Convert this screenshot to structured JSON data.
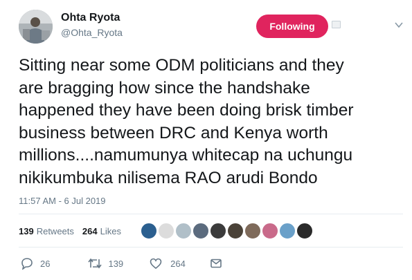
{
  "author": {
    "name": "Ohta Ryota",
    "handle": "@Ohta_Ryota",
    "avatar_icon": "user-photo"
  },
  "follow_button": {
    "label": "Following",
    "color": "#e0245e"
  },
  "tweet": {
    "text": "Sitting near some ODM politicians and they\nare bragging how since the handshake\nhappened they have been doing brisk timber\nbusiness between DRC and Kenya worth\nmillions....namumunya whitecap na uchungu\nnikikumbuka nilisema RAO arudi Bondo",
    "timestamp": "11:57 AM - 6 Jul 2019"
  },
  "stats": {
    "retweets_count": "139",
    "retweets_label": "Retweets",
    "likes_count": "264",
    "likes_label": "Likes"
  },
  "likers": [
    {
      "color": "#2b5f8f"
    },
    {
      "color": "#dcdcdc"
    },
    {
      "color": "#b0bfc8"
    },
    {
      "color": "#5b6b7e"
    },
    {
      "color": "#3b3b3b"
    },
    {
      "color": "#4a4238"
    },
    {
      "color": "#7e6a5a"
    },
    {
      "color": "#c96a8a"
    },
    {
      "color": "#6aa0c9"
    },
    {
      "color": "#2a2a2a"
    }
  ],
  "actions": {
    "reply_count": "26",
    "retweet_count": "139",
    "like_count": "264"
  }
}
